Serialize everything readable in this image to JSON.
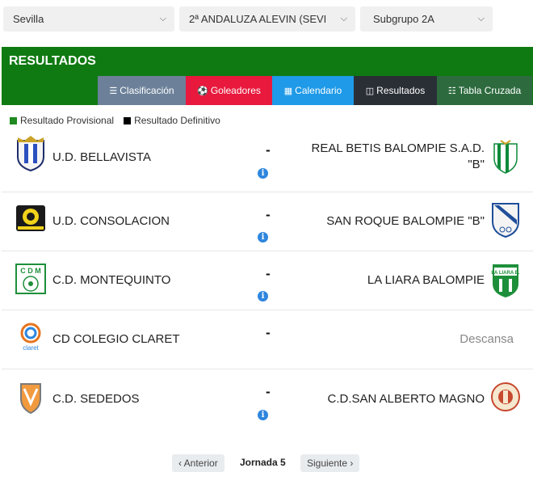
{
  "filters": {
    "province": "Sevilla",
    "category": "2ª ANDALUZA ALEVIN (SEVI",
    "group": "Subgrupo 2A"
  },
  "header": {
    "title": "RESULTADOS",
    "tabs": [
      {
        "label": "Clasificación",
        "icon": "list-icon",
        "color": "#6c8199"
      },
      {
        "label": "Goleadores",
        "icon": "soccer-ball-icon",
        "color": "#e8193d"
      },
      {
        "label": "Calendario",
        "icon": "calendar-icon",
        "color": "#1e9ae8"
      },
      {
        "label": "Resultados",
        "icon": "columns-icon",
        "color": "#2a2f36"
      },
      {
        "label": "Tabla Cruzada",
        "icon": "table-icon",
        "color": "#2d6b3f"
      }
    ],
    "color": "#0f7a12"
  },
  "legend": {
    "provisional": "Resultado Provisional",
    "definitivo": "Resultado Definitivo"
  },
  "matches": [
    {
      "home": "U.D. BELLAVISTA",
      "score": "-",
      "away_line1": "REAL BETIS BALOMPIE S.A.D.",
      "away_line2": "\"B\""
    },
    {
      "home": "U.D. CONSOLACION",
      "score": "-",
      "away": "SAN ROQUE BALOMPIE \"B\""
    },
    {
      "home": "C.D. MONTEQUINTO",
      "score": "-",
      "away": "LA LIARA BALOMPIE"
    },
    {
      "home": "CD COLEGIO CLARET",
      "score": "-",
      "away": "Descansa"
    },
    {
      "home": "C.D. SEDEDOS",
      "score": "-",
      "away": "C.D.SAN ALBERTO MAGNO"
    }
  ],
  "crest_text": {
    "montequinto": "C D M",
    "claret": "claret",
    "liara": "LA LIARA B."
  },
  "pager": {
    "prev": "Anterior",
    "current": "Jornada 5",
    "next": "Siguiente"
  }
}
